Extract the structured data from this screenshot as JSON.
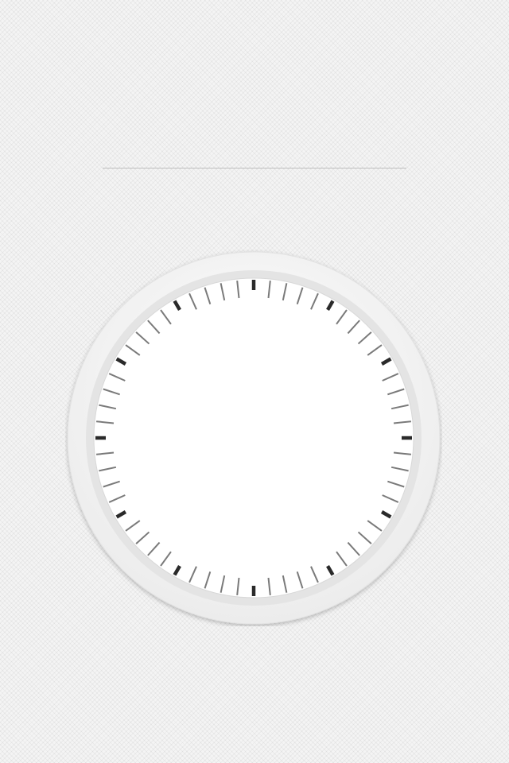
{
  "clock": {
    "ticks_total": 60,
    "major_every": 5,
    "colors": {
      "major_tick": "#2a2a2a",
      "minor_tick": "#7a7a7a",
      "face": "#ffffff",
      "bezel": "#f2f2f2",
      "inner_ring": "#dcdcdc"
    }
  }
}
